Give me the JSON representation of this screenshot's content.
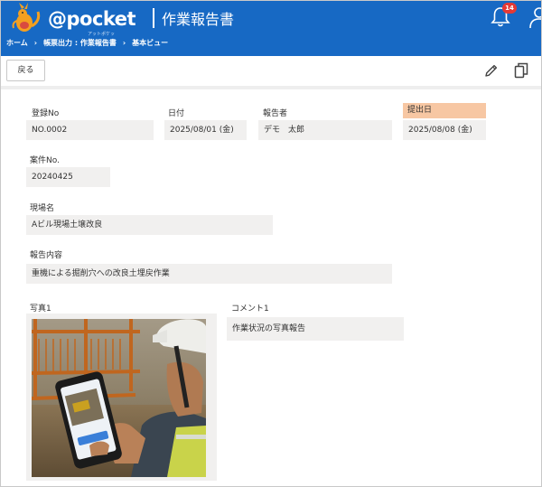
{
  "header": {
    "logo_text": "@pocket",
    "logo_sub": "アットポケット",
    "page_title": "作業報告書",
    "notification_count": "14",
    "accent_color": "#1769c4",
    "badge_color": "#e53935"
  },
  "breadcrumb": [
    "ホーム",
    "帳票出力 : 作業報告書",
    "基本ビュー"
  ],
  "toolbar": {
    "back_label": "戻る",
    "icons": [
      "edit-icon",
      "copy-icon"
    ]
  },
  "form": {
    "registration_no": {
      "label": "登録No",
      "value": "NO.0002"
    },
    "date": {
      "label": "日付",
      "value": "2025/08/01 (金)"
    },
    "reporter": {
      "label": "報告者",
      "value": "デモ　太郎"
    },
    "submission_date": {
      "label": "提出日",
      "value": "2025/08/08 (金)",
      "highlight_color": "#f7c7a3"
    },
    "case_no": {
      "label": "案件No.",
      "value": "20240425"
    },
    "site_name": {
      "label": "現場名",
      "value": "Aビル現場土壌改良"
    },
    "report_content": {
      "label": "報告内容",
      "value": "重機による掘削穴への改良土埋戻作業"
    },
    "photo1": {
      "label": "写真1"
    },
    "comment1": {
      "label": "コメント1",
      "value": "作業状況の写真報告"
    }
  }
}
